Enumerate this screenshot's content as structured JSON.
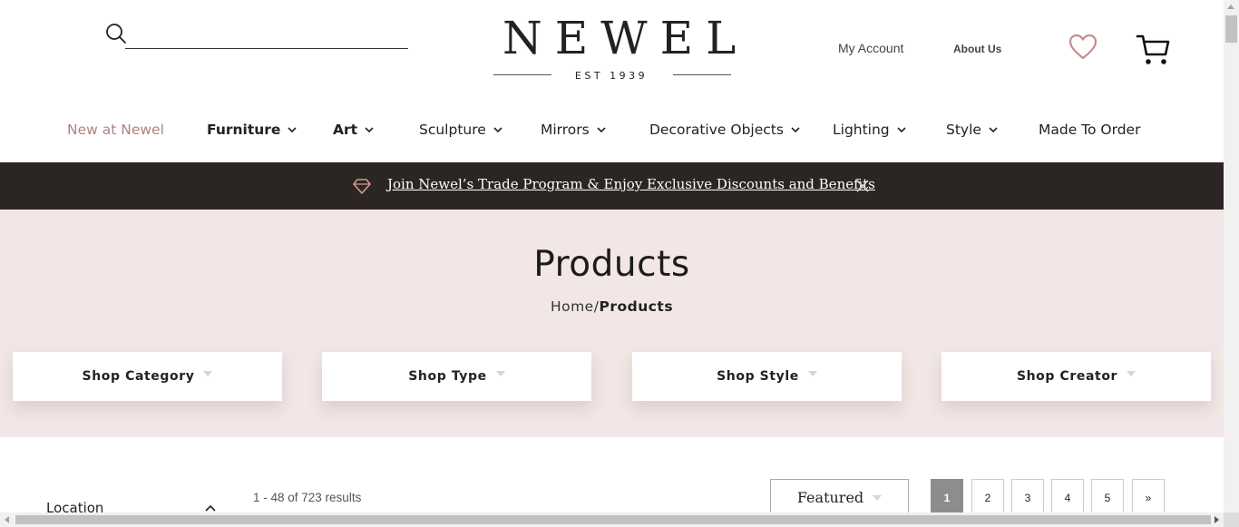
{
  "header": {
    "search_placeholder": "",
    "logo": {
      "word": "NEWEL",
      "sub": "EST 1939"
    },
    "my_account": "My Account",
    "about_us": "About Us",
    "icons": {
      "search": "search-icon",
      "wishlist": "heart-icon",
      "cart": "cart-icon"
    }
  },
  "nav": {
    "items": [
      {
        "label": "New at Newel"
      },
      {
        "label": "Furniture"
      },
      {
        "label": "Art"
      },
      {
        "label": "Sculpture"
      },
      {
        "label": "Mirrors"
      },
      {
        "label": "Decorative Objects"
      },
      {
        "label": "Lighting"
      },
      {
        "label": "Style"
      },
      {
        "label": "Made To Order"
      }
    ]
  },
  "promo": {
    "text": "Join Newel’s Trade Program & Enjoy Exclusive Discounts and Benefits"
  },
  "hero": {
    "title": "Products",
    "breadcrumb": {
      "home": "Home",
      "separator": "/",
      "current": "Products"
    },
    "filters": [
      "Shop Category",
      "Shop Type",
      "Shop Style",
      "Shop Creator"
    ]
  },
  "listing": {
    "sidebar_heading": "Location",
    "results_text": "1 - 48 of 723 results",
    "sort_label": "Featured",
    "pagination": [
      "1",
      "2",
      "3",
      "4",
      "5",
      "»"
    ],
    "current_page": "1"
  },
  "colors": {
    "accent": "#b38080",
    "promo_bg": "#2b2624",
    "hero_bg": "#f2e7e6",
    "active_page": "#8d8d8d"
  }
}
